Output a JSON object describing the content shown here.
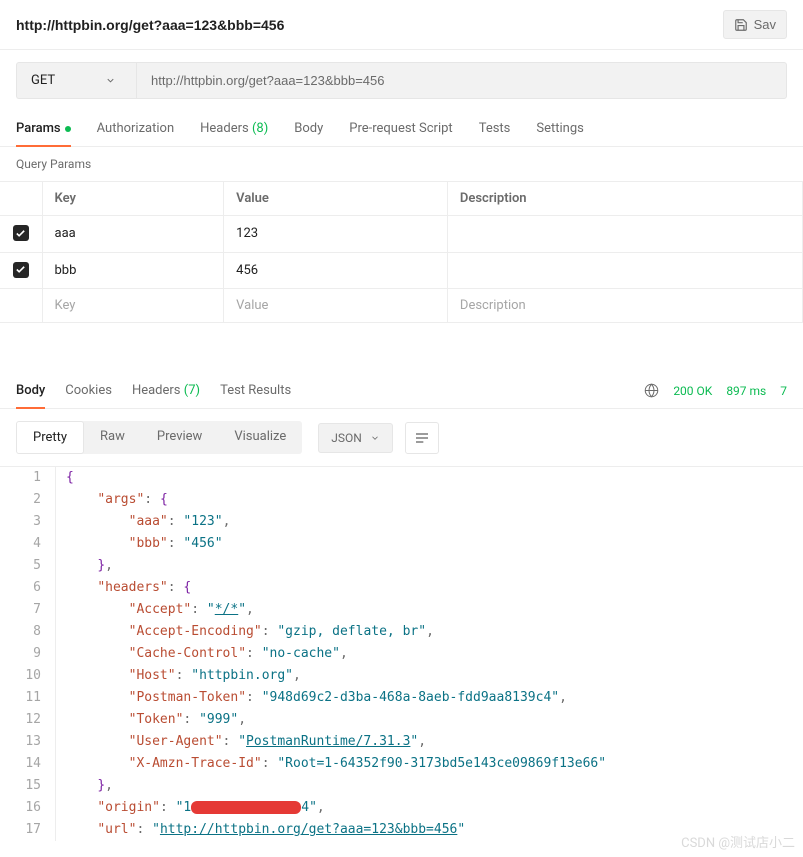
{
  "top": {
    "title": "http://httpbin.org/get?aaa=123&bbb=456",
    "save_label": "Sav"
  },
  "request": {
    "method": "GET",
    "url": "http://httpbin.org/get?aaa=123&bbb=456"
  },
  "tabs": {
    "params": "Params",
    "authorization": "Authorization",
    "headers": "Headers",
    "headers_count": "(8)",
    "body": "Body",
    "prereq": "Pre-request Script",
    "tests": "Tests",
    "settings": "Settings"
  },
  "params": {
    "subheader": "Query Params",
    "th_key": "Key",
    "th_value": "Value",
    "th_desc": "Description",
    "rows": [
      {
        "checked": true,
        "key": "aaa",
        "value": "123",
        "desc": ""
      },
      {
        "checked": true,
        "key": "bbb",
        "value": "456",
        "desc": ""
      }
    ],
    "ph_key": "Key",
    "ph_value": "Value",
    "ph_desc": "Description"
  },
  "response": {
    "tabs": {
      "body": "Body",
      "cookies": "Cookies",
      "headers": "Headers",
      "headers_count": "(7)",
      "test_results": "Test Results"
    },
    "meta": {
      "status": "200 OK",
      "time": "897 ms",
      "size_partial": "7"
    },
    "view_modes": {
      "pretty": "Pretty",
      "raw": "Raw",
      "preview": "Preview",
      "visualize": "Visualize"
    },
    "lang_label": "JSON"
  },
  "body_json": {
    "args": {
      "aaa": "123",
      "bbb": "456"
    },
    "headers": {
      "Accept": "*/*",
      "Accept-Encoding": "gzip, deflate, br",
      "Cache-Control": "no-cache",
      "Host": "httpbin.org",
      "Postman-Token": "948d69c2-d3ba-468a-8aeb-fdd9aa8139c4",
      "Token": "999",
      "User-Agent": "PostmanRuntime/7.31.3",
      "X-Amzn-Trace-Id": "Root=1-64352f90-3173bd5e143ce09869f13e66"
    },
    "origin_prefix": "1",
    "origin_suffix": "4",
    "url": "http://httpbin.org/get?aaa=123&bbb=456"
  },
  "watermark": "CSDN @测试店小二"
}
